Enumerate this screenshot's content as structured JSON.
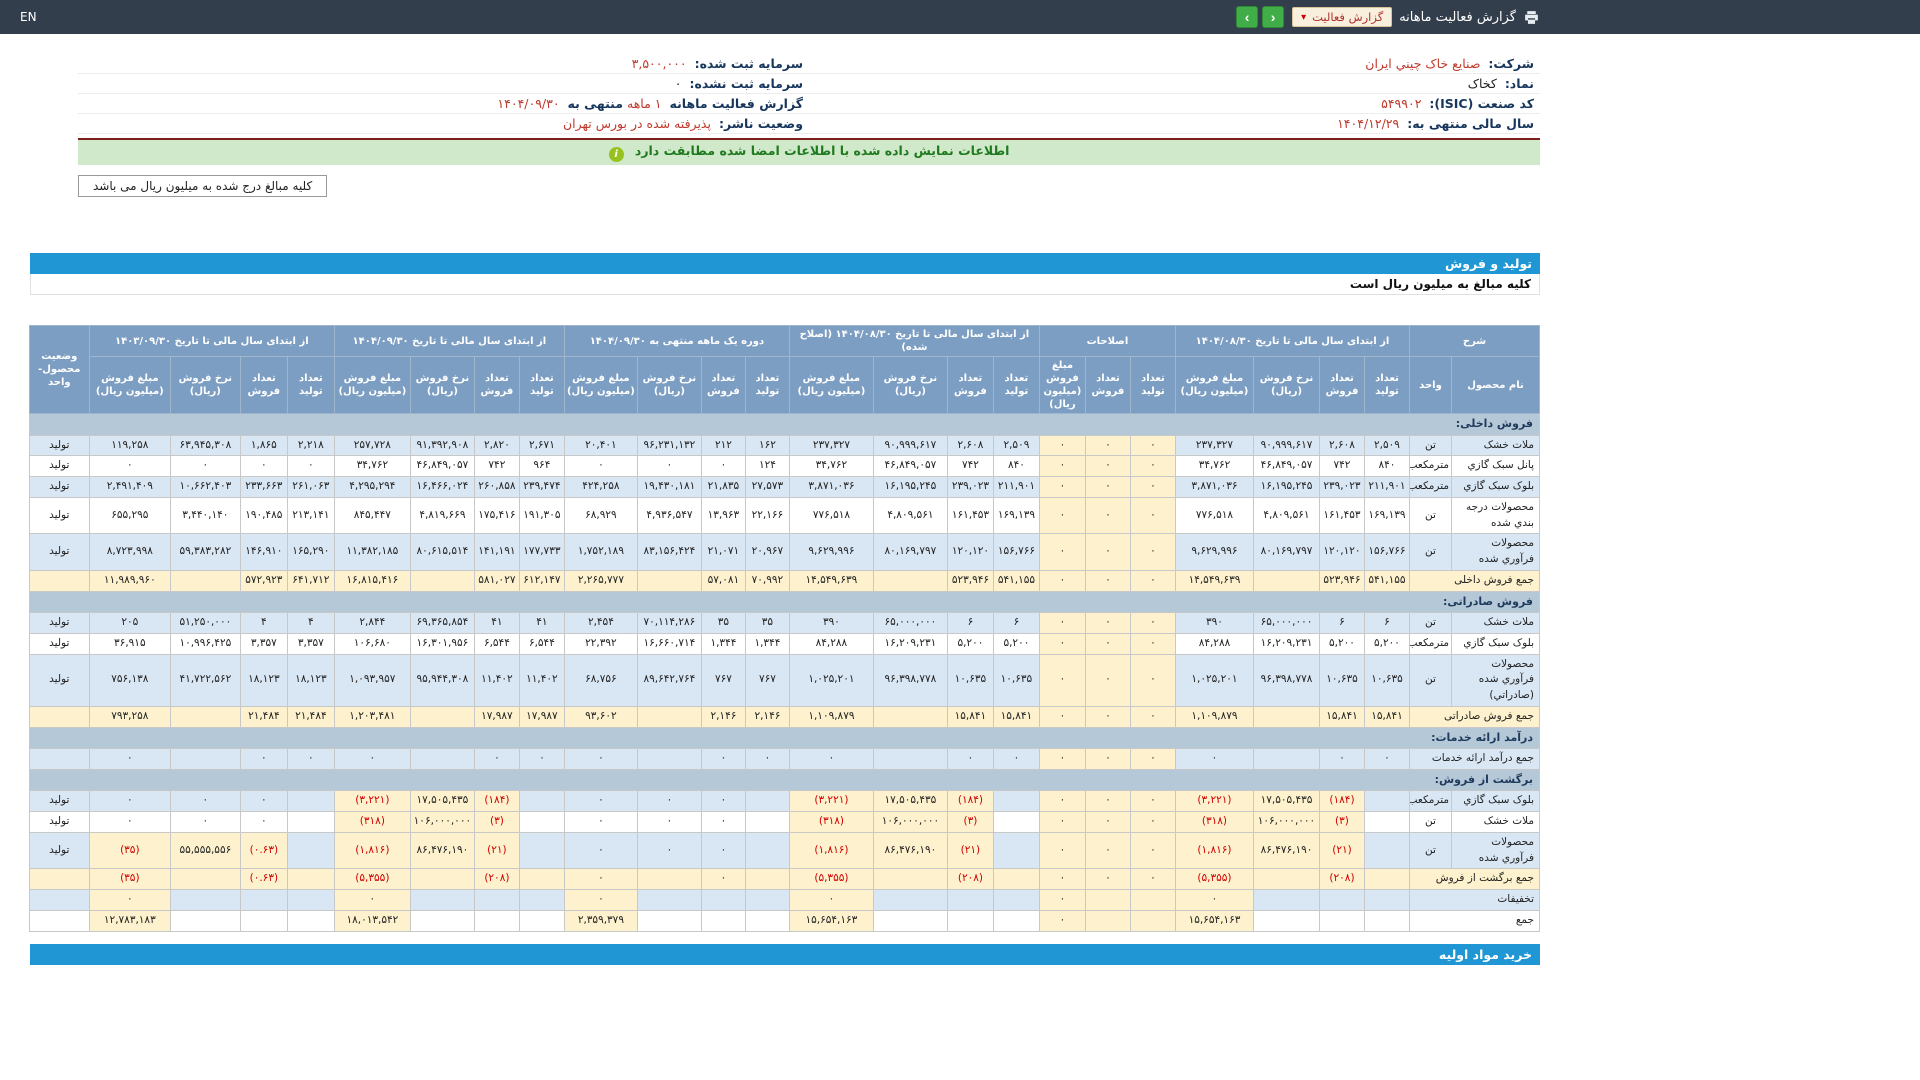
{
  "topbar": {
    "title": "گزارش فعالیت ماهانه",
    "report_select": "گزارش فعالیت",
    "lang": "EN"
  },
  "info": {
    "company_label": "شرکت:",
    "company": "صنایع خاک چيني ايران",
    "symbol_label": "نماد:",
    "symbol": "کخاک",
    "isic_label": "کد صنعت (ISIC):",
    "isic": "۵۴۹۹۰۲",
    "fiscal_label": "سال مالی منتهی به:",
    "fiscal": "۱۴۰۴/۱۲/۲۹",
    "capital_reg_label": "سرمایه ثبت شده:",
    "capital_reg": "۳,۵۰۰,۰۰۰",
    "capital_unreg_label": "سرمایه ثبت نشده:",
    "capital_unreg": "۰",
    "report_label": "گزارش فعالیت ماهانه",
    "report_period": "۱ ماهه",
    "report_mid": "منتهی به",
    "report_date": "۱۴۰۴/۰۹/۳۰",
    "status_label": "وضعیت ناشر:",
    "status": "پذيرفته شده در بورس تهران"
  },
  "banner": {
    "text": "اطلاعات نمایش داده شده با اطلاعات امضا شده مطابقت دارد",
    "icon": "i"
  },
  "units_note": "کلیه مبالغ درج شده به میلیون ریال می باشد",
  "section": {
    "title": "تولید و فروش",
    "note": "کلیه مبالغ به میلیون ریال است"
  },
  "bottom_bar": "خرید مواد اولیه",
  "colors": {
    "accent_blue": "#2097d4",
    "header_blue": "#7d9ec3",
    "row_blue": "#d9e6f4",
    "cream": "#fdf2cd",
    "section_bg": "#b5c8d7",
    "negative": "#d10000",
    "value_red": "#c0392b",
    "banner_green": "#cfe9ca",
    "topbar": "#333e4d",
    "button_green": "#41ad49"
  },
  "table": {
    "desc_header": "شرح",
    "product_col": "نام محصول",
    "unit_col": "واحد",
    "status_col": "وضعیت محصول-واحد",
    "groups": [
      {
        "key": "g1",
        "label": "از ابتدای سال مالی تا تاریخ ۱۴۰۴/۰۸/۳۰",
        "cols": [
          "تعداد تولید",
          "تعداد فروش",
          "نرخ فروش (ریال)",
          "مبلغ فروش (میلیون ریال)"
        ]
      },
      {
        "key": "ge",
        "label": "اصلاحات",
        "cols": [
          "تعداد تولید",
          "تعداد فروش",
          "مبلغ فروش (میلیون ریال)"
        ]
      },
      {
        "key": "g2",
        "label": "از ابتدای سال مالی تا تاریخ ۱۴۰۴/۰۸/۳۰ (اصلاح شده)",
        "cols": [
          "تعداد تولید",
          "تعداد فروش",
          "نرخ فروش (ریال)",
          "مبلغ فروش (میلیون ریال)"
        ]
      },
      {
        "key": "g3",
        "label": "دوره یک ماهه منتهی به ۱۴۰۴/۰۹/۳۰",
        "cols": [
          "تعداد تولید",
          "تعداد فروش",
          "نرخ فروش (ریال)",
          "مبلغ فروش (میلیون ریال)"
        ]
      },
      {
        "key": "g4",
        "label": "از ابتدای سال مالی تا تاریخ ۱۴۰۴/۰۹/۳۰",
        "cols": [
          "تعداد تولید",
          "تعداد فروش",
          "نرخ فروش (ریال)",
          "مبلغ فروش (میلیون ریال)"
        ]
      },
      {
        "key": "g5",
        "label": "از ابتدای سال مالی تا تاریخ ۱۴۰۳/۰۹/۳۰",
        "cols": [
          "تعداد تولید",
          "تعداد فروش",
          "نرخ فروش (ریال)",
          "مبلغ فروش (میلیون ریال)"
        ]
      }
    ],
    "rows": [
      {
        "type": "section",
        "label": "فروش داخلی:"
      },
      {
        "type": "data",
        "bg": "b",
        "product": "ملات خشک",
        "unit": "تن",
        "status": "تولید",
        "cells": {
          "g1": [
            "۲,۵۰۹",
            "۲,۶۰۸",
            "۹۰,۹۹۹,۶۱۷",
            "۲۳۷,۳۲۷"
          ],
          "ge": [
            "۰",
            "۰",
            "۰"
          ],
          "g2": [
            "۲,۵۰۹",
            "۲,۶۰۸",
            "۹۰,۹۹۹,۶۱۷",
            "۲۳۷,۳۲۷"
          ],
          "g3": [
            "۱۶۲",
            "۲۱۲",
            "۹۶,۲۳۱,۱۳۲",
            "۲۰,۴۰۱"
          ],
          "g4": [
            "۲,۶۷۱",
            "۲,۸۲۰",
            "۹۱,۳۹۲,۹۰۸",
            "۲۵۷,۷۲۸"
          ],
          "g5": [
            "۲,۲۱۸",
            "۱,۸۶۵",
            "۶۳,۹۴۵,۳۰۸",
            "۱۱۹,۲۵۸"
          ]
        }
      },
      {
        "type": "data",
        "bg": "w",
        "product": "پانل سبک گازي",
        "unit": "مترمکعب",
        "status": "تولید",
        "cells": {
          "g1": [
            "۸۴۰",
            "۷۴۲",
            "۴۶,۸۴۹,۰۵۷",
            "۳۴,۷۶۲"
          ],
          "ge": [
            "۰",
            "۰",
            "۰"
          ],
          "g2": [
            "۸۴۰",
            "۷۴۲",
            "۴۶,۸۴۹,۰۵۷",
            "۳۴,۷۶۲"
          ],
          "g3": [
            "۱۲۴",
            "۰",
            "۰",
            "۰"
          ],
          "g4": [
            "۹۶۴",
            "۷۴۲",
            "۴۶,۸۴۹,۰۵۷",
            "۳۴,۷۶۲"
          ],
          "g5": [
            "۰",
            "۰",
            "۰",
            "۰"
          ]
        }
      },
      {
        "type": "data",
        "bg": "b",
        "product": "بلوک سبک گازي",
        "unit": "مترمکعب",
        "status": "تولید",
        "cells": {
          "g1": [
            "۲۱۱,۹۰۱",
            "۲۳۹,۰۲۳",
            "۱۶,۱۹۵,۲۴۵",
            "۳,۸۷۱,۰۳۶"
          ],
          "ge": [
            "۰",
            "۰",
            "۰"
          ],
          "g2": [
            "۲۱۱,۹۰۱",
            "۲۳۹,۰۲۳",
            "۱۶,۱۹۵,۲۴۵",
            "۳,۸۷۱,۰۳۶"
          ],
          "g3": [
            "۲۷,۵۷۳",
            "۲۱,۸۳۵",
            "۱۹,۴۳۰,۱۸۱",
            "۴۲۴,۲۵۸"
          ],
          "g4": [
            "۲۳۹,۴۷۴",
            "۲۶۰,۸۵۸",
            "۱۶,۴۶۶,۰۲۴",
            "۴,۲۹۵,۲۹۴"
          ],
          "g5": [
            "۲۶۱,۰۶۳",
            "۲۳۳,۶۶۳",
            "۱۰,۶۶۲,۴۰۳",
            "۲,۴۹۱,۴۰۹"
          ]
        }
      },
      {
        "type": "data",
        "bg": "w",
        "product": "محصولات درجه بندي شده",
        "unit": "تن",
        "status": "تولید",
        "cells": {
          "g1": [
            "۱۶۹,۱۳۹",
            "۱۶۱,۴۵۳",
            "۴,۸۰۹,۵۶۱",
            "۷۷۶,۵۱۸"
          ],
          "ge": [
            "۰",
            "۰",
            "۰"
          ],
          "g2": [
            "۱۶۹,۱۳۹",
            "۱۶۱,۴۵۳",
            "۴,۸۰۹,۵۶۱",
            "۷۷۶,۵۱۸"
          ],
          "g3": [
            "۲۲,۱۶۶",
            "۱۳,۹۶۳",
            "۴,۹۳۶,۵۴۷",
            "۶۸,۹۲۹"
          ],
          "g4": [
            "۱۹۱,۳۰۵",
            "۱۷۵,۴۱۶",
            "۴,۸۱۹,۶۶۹",
            "۸۴۵,۴۴۷"
          ],
          "g5": [
            "۲۱۳,۱۴۱",
            "۱۹۰,۴۸۵",
            "۳,۴۴۰,۱۴۰",
            "۶۵۵,۲۹۵"
          ]
        }
      },
      {
        "type": "data",
        "bg": "b",
        "product": "محصولات فرآوري شده",
        "unit": "تن",
        "status": "تولید",
        "cells": {
          "g1": [
            "۱۵۶,۷۶۶",
            "۱۲۰,۱۲۰",
            "۸۰,۱۶۹,۷۹۷",
            "۹,۶۲۹,۹۹۶"
          ],
          "ge": [
            "۰",
            "۰",
            "۰"
          ],
          "g2": [
            "۱۵۶,۷۶۶",
            "۱۲۰,۱۲۰",
            "۸۰,۱۶۹,۷۹۷",
            "۹,۶۲۹,۹۹۶"
          ],
          "g3": [
            "۲۰,۹۶۷",
            "۲۱,۰۷۱",
            "۸۳,۱۵۶,۴۲۴",
            "۱,۷۵۲,۱۸۹"
          ],
          "g4": [
            "۱۷۷,۷۳۳",
            "۱۴۱,۱۹۱",
            "۸۰,۶۱۵,۵۱۴",
            "۱۱,۳۸۲,۱۸۵"
          ],
          "g5": [
            "۱۶۵,۲۹۰",
            "۱۴۶,۹۱۰",
            "۵۹,۳۸۳,۲۸۲",
            "۸,۷۲۳,۹۹۸"
          ]
        }
      },
      {
        "type": "total",
        "label": "جمع فروش داخلی",
        "cells": {
          "g1": [
            "۵۴۱,۱۵۵",
            "۵۲۳,۹۴۶",
            "",
            "۱۴,۵۴۹,۶۳۹"
          ],
          "ge": [
            "۰",
            "۰",
            "۰"
          ],
          "g2": [
            "۵۴۱,۱۵۵",
            "۵۲۳,۹۴۶",
            "",
            "۱۴,۵۴۹,۶۳۹"
          ],
          "g3": [
            "۷۰,۹۹۲",
            "۵۷,۰۸۱",
            "",
            "۲,۲۶۵,۷۷۷"
          ],
          "g4": [
            "۶۱۲,۱۴۷",
            "۵۸۱,۰۲۷",
            "",
            "۱۶,۸۱۵,۴۱۶"
          ],
          "g5": [
            "۶۴۱,۷۱۲",
            "۵۷۲,۹۲۳",
            "",
            "۱۱,۹۸۹,۹۶۰"
          ]
        }
      },
      {
        "type": "section",
        "label": "فروش صادراتی:"
      },
      {
        "type": "data",
        "bg": "b",
        "product": "ملات خشک",
        "unit": "تن",
        "status": "تولید",
        "cells": {
          "g1": [
            "۶",
            "۶",
            "۶۵,۰۰۰,۰۰۰",
            "۳۹۰"
          ],
          "ge": [
            "۰",
            "۰",
            "۰"
          ],
          "g2": [
            "۶",
            "۶",
            "۶۵,۰۰۰,۰۰۰",
            "۳۹۰"
          ],
          "g3": [
            "۳۵",
            "۳۵",
            "۷۰,۱۱۴,۲۸۶",
            "۲,۴۵۴"
          ],
          "g4": [
            "۴۱",
            "۴۱",
            "۶۹,۳۶۵,۸۵۴",
            "۲,۸۴۴"
          ],
          "g5": [
            "۴",
            "۴",
            "۵۱,۲۵۰,۰۰۰",
            "۲۰۵"
          ]
        }
      },
      {
        "type": "data",
        "bg": "w",
        "product": "بلوک سبک گازي",
        "unit": "مترمکعب",
        "status": "تولید",
        "cells": {
          "g1": [
            "۵,۲۰۰",
            "۵,۲۰۰",
            "۱۶,۲۰۹,۲۳۱",
            "۸۴,۲۸۸"
          ],
          "ge": [
            "۰",
            "۰",
            "۰"
          ],
          "g2": [
            "۵,۲۰۰",
            "۵,۲۰۰",
            "۱۶,۲۰۹,۲۳۱",
            "۸۴,۲۸۸"
          ],
          "g3": [
            "۱,۳۴۴",
            "۱,۳۴۴",
            "۱۶,۶۶۰,۷۱۴",
            "۲۲,۳۹۲"
          ],
          "g4": [
            "۶,۵۴۴",
            "۶,۵۴۴",
            "۱۶,۳۰۱,۹۵۶",
            "۱۰۶,۶۸۰"
          ],
          "g5": [
            "۳,۳۵۷",
            "۳,۳۵۷",
            "۱۰,۹۹۶,۴۲۵",
            "۳۶,۹۱۵"
          ]
        }
      },
      {
        "type": "data",
        "bg": "b",
        "product": "محصولات فرآوري شده (صادراتي)",
        "unit": "تن",
        "status": "تولید",
        "cells": {
          "g1": [
            "۱۰,۶۳۵",
            "۱۰,۶۳۵",
            "۹۶,۳۹۸,۷۷۸",
            "۱,۰۲۵,۲۰۱"
          ],
          "ge": [
            "۰",
            "۰",
            "۰"
          ],
          "g2": [
            "۱۰,۶۳۵",
            "۱۰,۶۳۵",
            "۹۶,۳۹۸,۷۷۸",
            "۱,۰۲۵,۲۰۱"
          ],
          "g3": [
            "۷۶۷",
            "۷۶۷",
            "۸۹,۶۴۲,۷۶۴",
            "۶۸,۷۵۶"
          ],
          "g4": [
            "۱۱,۴۰۲",
            "۱۱,۴۰۲",
            "۹۵,۹۴۴,۳۰۸",
            "۱,۰۹۳,۹۵۷"
          ],
          "g5": [
            "۱۸,۱۲۳",
            "۱۸,۱۲۳",
            "۴۱,۷۲۲,۵۶۲",
            "۷۵۶,۱۳۸"
          ]
        }
      },
      {
        "type": "total",
        "label": "جمع فروش صادراتی",
        "cells": {
          "g1": [
            "۱۵,۸۴۱",
            "۱۵,۸۴۱",
            "",
            "۱,۱۰۹,۸۷۹"
          ],
          "ge": [
            "۰",
            "۰",
            "۰"
          ],
          "g2": [
            "۱۵,۸۴۱",
            "۱۵,۸۴۱",
            "",
            "۱,۱۰۹,۸۷۹"
          ],
          "g3": [
            "۲,۱۴۶",
            "۲,۱۴۶",
            "",
            "۹۳,۶۰۲"
          ],
          "g4": [
            "۱۷,۹۸۷",
            "۱۷,۹۸۷",
            "",
            "۱,۲۰۳,۴۸۱"
          ],
          "g5": [
            "۲۱,۴۸۴",
            "۲۱,۴۸۴",
            "",
            "۷۹۳,۲۵۸"
          ]
        }
      },
      {
        "type": "section",
        "label": "درآمد ارائه خدمات:"
      },
      {
        "type": "total",
        "plain": true,
        "bg": "b",
        "label": "جمع درآمد ارائه خدمات",
        "cells": {
          "g1": [
            "۰",
            "۰",
            "",
            "۰"
          ],
          "ge": [
            "۰",
            "۰",
            "۰"
          ],
          "g2": [
            "۰",
            "۰",
            "",
            "۰"
          ],
          "g3": [
            "۰",
            "۰",
            "",
            "۰"
          ],
          "g4": [
            "۰",
            "۰",
            "",
            "۰"
          ],
          "g5": [
            "۰",
            "۰",
            "",
            "۰"
          ]
        }
      },
      {
        "type": "section",
        "label": "برگشت از فروش:"
      },
      {
        "type": "data",
        "bg": "b",
        "product": "بلوک سبک گازي",
        "unit": "مترمکعب",
        "status": "تولید",
        "cells": {
          "g1": [
            "",
            {
              "v": "(۱۸۴)",
              "hl": true
            },
            {
              "v": "۱۷,۵۰۵,۴۳۵",
              "hl": true
            },
            {
              "v": "(۳,۲۲۱)",
              "hl": true
            }
          ],
          "ge": [
            "۰",
            "۰",
            "۰"
          ],
          "g2": [
            "",
            {
              "v": "(۱۸۴)",
              "hl": true
            },
            {
              "v": "۱۷,۵۰۵,۴۳۵",
              "hl": true
            },
            {
              "v": "(۳,۲۲۱)",
              "hl": true
            }
          ],
          "g3": [
            "",
            "۰",
            "۰",
            "۰"
          ],
          "g4": [
            "",
            {
              "v": "(۱۸۴)",
              "hl": true
            },
            {
              "v": "۱۷,۵۰۵,۴۳۵",
              "hl": true
            },
            {
              "v": "(۳,۲۲۱)",
              "hl": true
            }
          ],
          "g5": [
            "",
            "۰",
            "۰",
            "۰"
          ]
        }
      },
      {
        "type": "data",
        "bg": "w",
        "product": "ملات خشک",
        "unit": "تن",
        "status": "تولید",
        "cells": {
          "g1": [
            "",
            {
              "v": "(۳)",
              "hl": true
            },
            {
              "v": "۱۰۶,۰۰۰,۰۰۰",
              "hl": true
            },
            {
              "v": "(۳۱۸)",
              "hl": true
            }
          ],
          "ge": [
            "۰",
            "۰",
            "۰"
          ],
          "g2": [
            "",
            {
              "v": "(۳)",
              "hl": true
            },
            {
              "v": "۱۰۶,۰۰۰,۰۰۰",
              "hl": true
            },
            {
              "v": "(۳۱۸)",
              "hl": true
            }
          ],
          "g3": [
            "",
            "۰",
            "۰",
            "۰"
          ],
          "g4": [
            "",
            {
              "v": "(۳)",
              "hl": true
            },
            {
              "v": "۱۰۶,۰۰۰,۰۰۰",
              "hl": true
            },
            {
              "v": "(۳۱۸)",
              "hl": true
            }
          ],
          "g5": [
            "",
            "۰",
            "۰",
            "۰"
          ]
        }
      },
      {
        "type": "data",
        "bg": "b",
        "product": "محصولات فرآوري شده",
        "unit": "تن",
        "status": "تولید",
        "cells": {
          "g1": [
            "",
            {
              "v": "(۲۱)",
              "hl": true
            },
            {
              "v": "۸۶,۴۷۶,۱۹۰",
              "hl": true
            },
            {
              "v": "(۱,۸۱۶)",
              "hl": true
            }
          ],
          "ge": [
            "۰",
            "۰",
            "۰"
          ],
          "g2": [
            "",
            {
              "v": "(۲۱)",
              "hl": true
            },
            {
              "v": "۸۶,۴۷۶,۱۹۰",
              "hl": true
            },
            {
              "v": "(۱,۸۱۶)",
              "hl": true
            }
          ],
          "g3": [
            "",
            "۰",
            "۰",
            "۰"
          ],
          "g4": [
            "",
            {
              "v": "(۲۱)",
              "hl": true
            },
            {
              "v": "۸۶,۴۷۶,۱۹۰",
              "hl": true
            },
            {
              "v": "(۱,۸۱۶)",
              "hl": true
            }
          ],
          "g5": [
            "",
            {
              "v": "(۰.۶۳)",
              "hl": true
            },
            {
              "v": "۵۵,۵۵۵,۵۵۶",
              "hl": true
            },
            {
              "v": "(۳۵)",
              "hl": true
            }
          ]
        }
      },
      {
        "type": "total",
        "label": "جمع برگشت از فروش",
        "cells": {
          "g1": [
            "",
            "(۲۰۸)",
            "",
            "(۵,۳۵۵)"
          ],
          "ge": [
            "۰",
            "۰",
            "۰"
          ],
          "g2": [
            "",
            "(۲۰۸)",
            "",
            "(۵,۳۵۵)"
          ],
          "g3": [
            "",
            "۰",
            "",
            "۰"
          ],
          "g4": [
            "",
            "(۲۰۸)",
            "",
            "(۵,۳۵۵)"
          ],
          "g5": [
            "",
            "(۰.۶۳)",
            "",
            "(۳۵)"
          ]
        }
      },
      {
        "type": "total",
        "plain": true,
        "bg": "b",
        "label": "تخفیفات",
        "cells": {
          "g1": [
            "",
            "",
            "",
            {
              "v": "۰",
              "hl": true
            }
          ],
          "ge": [
            "",
            "",
            "۰"
          ],
          "g2": [
            "",
            "",
            "",
            {
              "v": "۰",
              "hl": true
            }
          ],
          "g3": [
            "",
            "",
            "",
            {
              "v": "۰",
              "hl": true
            }
          ],
          "g4": [
            "",
            "",
            "",
            {
              "v": "۰",
              "hl": true
            }
          ],
          "g5": [
            "",
            "",
            "",
            {
              "v": "۰",
              "hl": true
            }
          ]
        }
      },
      {
        "type": "total",
        "plain": true,
        "bg": "w",
        "label": "جمع",
        "cells": {
          "g1": [
            "",
            "",
            "",
            {
              "v": "۱۵,۶۵۴,۱۶۳",
              "hl": true
            }
          ],
          "ge": [
            "",
            "",
            "۰"
          ],
          "g2": [
            "",
            "",
            "",
            {
              "v": "۱۵,۶۵۴,۱۶۳",
              "hl": true
            }
          ],
          "g3": [
            "",
            "",
            "",
            {
              "v": "۲,۳۵۹,۳۷۹",
              "hl": true
            }
          ],
          "g4": [
            "",
            "",
            "",
            {
              "v": "۱۸,۰۱۳,۵۴۲",
              "hl": true
            }
          ],
          "g5": [
            "",
            "",
            "",
            {
              "v": "۱۲,۷۸۳,۱۸۳",
              "hl": true
            }
          ]
        }
      }
    ]
  }
}
